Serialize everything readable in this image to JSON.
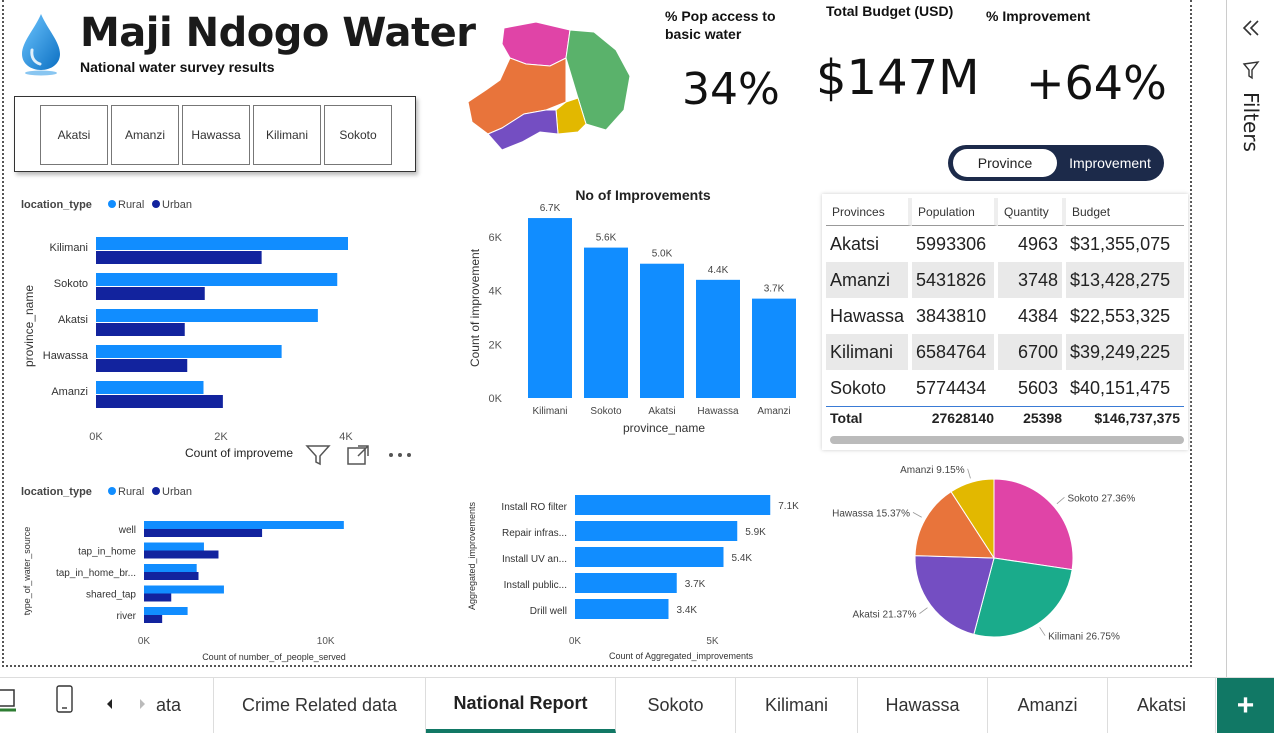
{
  "header": {
    "title": "Maji Ndogo Water",
    "subtitle": "National water survey results"
  },
  "slicer": {
    "items": [
      "Akatsi",
      "Amanzi",
      "Hawassa",
      "Kilimani",
      "Sokoto"
    ]
  },
  "kpis": {
    "pop_access": {
      "label": "% Pop access to basic water",
      "value": "34%"
    },
    "budget": {
      "label": "Total Budget (USD)",
      "value": "$147M"
    },
    "improvement": {
      "label": "% Improvement",
      "value": "+64%"
    }
  },
  "toggle": {
    "left": "Province",
    "right": "Improvement"
  },
  "colors": {
    "rural": "#118dff",
    "urban": "#12239e",
    "tab_accent": "#117865"
  },
  "map": {
    "regions": [
      {
        "name": "Kilimani",
        "color": "#e044a7"
      },
      {
        "name": "Sokoto",
        "color": "#5ab26b"
      },
      {
        "name": "Hawassa",
        "color": "#e8743b"
      },
      {
        "name": "Amanzi",
        "color": "#e2b800"
      },
      {
        "name": "Akatsi",
        "color": "#744ec2"
      }
    ]
  },
  "table": {
    "headers": [
      "Provinces",
      "Population",
      "Quantity",
      "Budget"
    ],
    "rows": [
      [
        "Akatsi",
        "5993306",
        "4963",
        "$31,355,075"
      ],
      [
        "Amanzi",
        "5431826",
        "3748",
        "$13,428,275"
      ],
      [
        "Hawassa",
        "3843810",
        "4384",
        "$22,553,325"
      ],
      [
        "Kilimani",
        "6584764",
        "6700",
        "$39,249,225"
      ],
      [
        "Sokoto",
        "5774434",
        "5603",
        "$40,151,475"
      ]
    ],
    "total": [
      "Total",
      "27628140",
      "25398",
      "$146,737,375"
    ]
  },
  "visual_header": {
    "filter_icon": "filter-icon",
    "focus_icon": "focus-mode-icon",
    "more_icon": "more-options-icon"
  },
  "right_pane": {
    "label": "Filters",
    "collapse_icon": "double-chevron-left-icon",
    "filter_icon": "filter-outline-icon"
  },
  "tabs": {
    "items": [
      "ata",
      "Crime Related data",
      "National Report",
      "Sokoto",
      "Kilimani",
      "Hawassa",
      "Amanzi",
      "Akatsi"
    ],
    "active": "National Report",
    "add_label": "+"
  },
  "chart_data": [
    {
      "id": "province-bars",
      "type": "bar",
      "orientation": "horizontal",
      "xlabel": "Count of improveme",
      "ylabel": "province_name",
      "legend_title": "location_type",
      "categories": [
        "Kilimani",
        "Sokoto",
        "Akatsi",
        "Hawassa",
        "Amanzi"
      ],
      "series": [
        {
          "name": "Rural",
          "values": [
            4050,
            3860,
            3550,
            2970,
            1720
          ]
        },
        {
          "name": "Urban",
          "values": [
            2650,
            1740,
            1420,
            1460,
            2030
          ]
        }
      ],
      "xlim": [
        0,
        4000
      ],
      "xticks": [
        "0K",
        "2K",
        "4K"
      ]
    },
    {
      "id": "improvements-bars",
      "type": "bar",
      "title": "No of Improvements",
      "xlabel": "province_name",
      "ylabel": "Count of improvement",
      "categories": [
        "Kilimani",
        "Sokoto",
        "Akatsi",
        "Hawassa",
        "Amanzi"
      ],
      "values": [
        6700,
        5600,
        5000,
        4400,
        3700
      ],
      "data_labels": [
        "6.7K",
        "5.6K",
        "5.0K",
        "4.4K",
        "3.7K"
      ],
      "ylim": [
        0,
        7000
      ],
      "yticks": [
        "0K",
        "2K",
        "4K",
        "6K"
      ]
    },
    {
      "id": "source-bars",
      "type": "bar",
      "orientation": "horizontal",
      "xlabel": "Count of number_of_people_served",
      "ylabel": "type_of_water_source",
      "legend_title": "location_type",
      "categories": [
        "well",
        "tap_in_home",
        "tap_in_home_br...",
        "shared_tap",
        "river"
      ],
      "series": [
        {
          "name": "Rural",
          "values": [
            11000,
            3300,
            2900,
            4400,
            2400
          ]
        },
        {
          "name": "Urban",
          "values": [
            6500,
            4100,
            3000,
            1500,
            1000
          ]
        }
      ],
      "xlim": [
        0,
        12000
      ],
      "xticks": [
        "0K",
        "10K"
      ]
    },
    {
      "id": "action-bars",
      "type": "bar",
      "orientation": "horizontal",
      "xlabel": "Count of Aggregated_improvements",
      "ylabel": "Aggregated_improvements",
      "categories": [
        "Install RO filter",
        "Repair infras...",
        "Install UV an...",
        "Install public...",
        "Drill well"
      ],
      "values": [
        7100,
        5900,
        5400,
        3700,
        3400
      ],
      "data_labels": [
        "7.1K",
        "5.9K",
        "5.4K",
        "3.7K",
        "3.4K"
      ],
      "xlim": [
        0,
        8000
      ],
      "xticks": [
        "0K",
        "5K"
      ]
    },
    {
      "id": "province-pie",
      "type": "pie",
      "categories": [
        "Sokoto",
        "Kilimani",
        "Akatsi",
        "Hawassa",
        "Amanzi"
      ],
      "values": [
        27.36,
        26.75,
        21.37,
        15.37,
        9.15
      ],
      "labels": [
        "Sokoto 27.36%",
        "Kilimani 26.75%",
        "Akatsi 21.37%",
        "Hawassa 15.37%",
        "Amanzi 9.15%"
      ],
      "colors": [
        "#e044a7",
        "#1aab8b",
        "#744ec2",
        "#e8743b",
        "#e2b800"
      ]
    }
  ]
}
